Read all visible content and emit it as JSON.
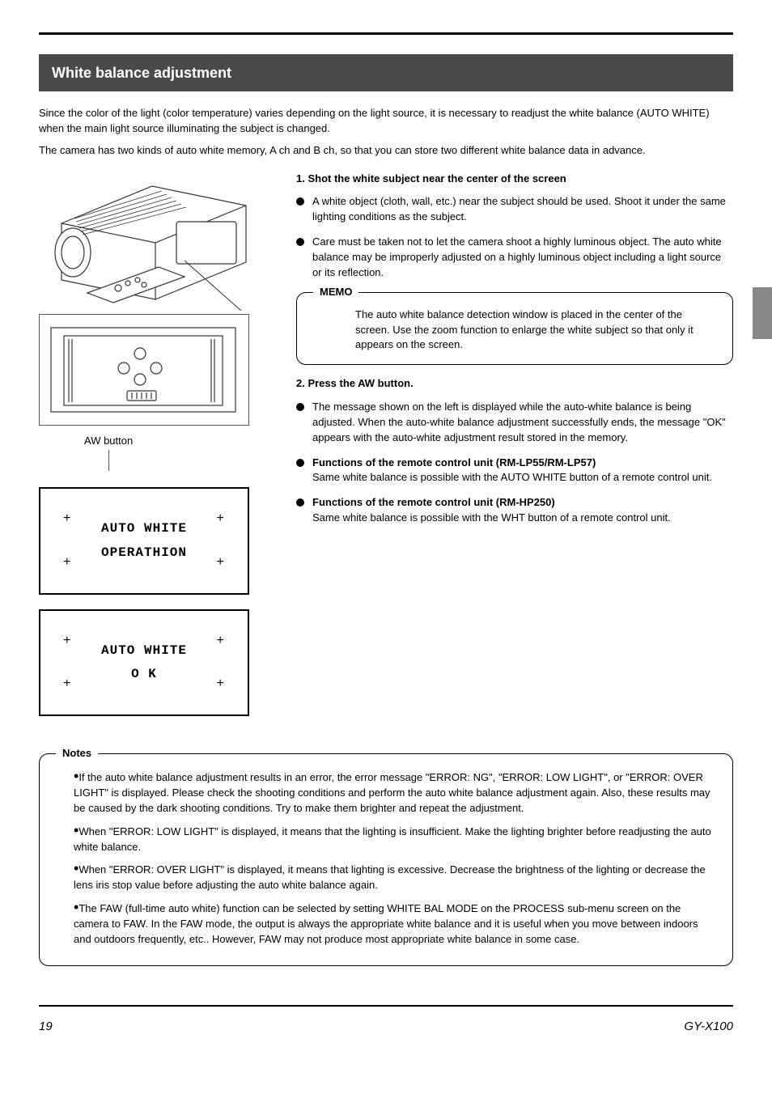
{
  "header": {
    "section_title": "White balance adjustment"
  },
  "intro": {
    "line1": "Since the color of the light (color temperature) varies depending on the light source, it is necessary to readjust the white balance (AUTO WHITE) when the main light source illuminating the subject is changed.",
    "line2": "The camera has two kinds of auto white memory, A ch and B ch, so that you can store two different white balance data in advance."
  },
  "camera_label": {
    "aw_button": "AW button"
  },
  "screen1": {
    "line1": "AUTO WHITE",
    "line2": "OPERATHION"
  },
  "screen2": {
    "line1": "AUTO WHITE",
    "line2": "O K"
  },
  "step1": {
    "title": "1. Shot the white subject near the center of the screen",
    "bullet1": "A white object (cloth, wall, etc.) near the subject should be used. Shoot it under the same lighting conditions as the subject.",
    "bullet2": "Care must be taken not to let the camera shoot a highly luminous object. The auto white balance may be improperly adjusted on a highly luminous object including a light source or its reflection.",
    "memo_text": "The auto white balance detection window is placed in the center of the screen. Use the zoom function to enlarge the white subject so that only it appears on the screen."
  },
  "step2": {
    "title": "2. Press the AW button.",
    "bullet1": "The message shown on the left is displayed while the auto-white balance is being adjusted. When the auto-white balance adjustment successfully ends, the message \"OK\" appears with the auto-white adjustment result stored in the memory.",
    "bullet2_label": "Functions of the remote control unit (RM-LP55/RM-LP57)",
    "bullet2_text": "Same white balance is possible with the AUTO WHITE button of a remote control unit.",
    "bullet3_label": "Functions of the remote control unit (RM-HP250)",
    "bullet3_text": "Same white balance is possible with the WHT button of a remote control unit."
  },
  "notes": {
    "label": "Notes",
    "n1": "If the auto white balance adjustment results in an error, the error message \"ERROR: NG\", \"ERROR: LOW LIGHT\", or \"ERROR: OVER LIGHT\" is displayed. Please check the shooting conditions and perform the auto white balance adjustment again. Also, these results may be caused by the dark shooting conditions. Try to make them brighter and repeat the adjustment.",
    "n2": "When \"ERROR: LOW LIGHT\" is displayed, it means that the lighting is insufficient. Make the lighting brighter before readjusting the auto white balance.",
    "n3": "When \"ERROR: OVER LIGHT\" is displayed, it means that lighting is excessive. Decrease the brightness of the lighting or decrease the lens iris stop value before adjusting the auto white balance again.",
    "n4": "The FAW (full-time auto white) function can be selected by setting WHITE BAL MODE on the PROCESS sub-menu screen on the camera to FAW. In the FAW mode, the output is always the appropriate white balance and it is useful when you move between indoors and outdoors frequently, etc.. However, FAW may not produce most appropriate white balance in some case."
  },
  "footer": {
    "page": "19",
    "model": "GY-X100"
  }
}
